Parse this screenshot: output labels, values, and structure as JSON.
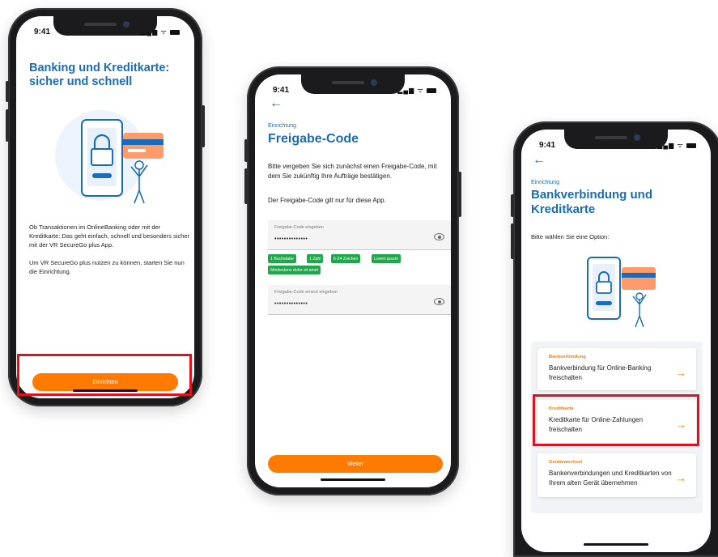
{
  "status_time": "9:41",
  "screen1": {
    "title": "Banking und Kreditkarte: sicher und schnell",
    "paragraph1": "Ob Transaktionen im OnlineBanking oder mit der Kreditkarte: Das geht einfach, schnell und besonders sicher mit der VR SecureGo plus App.",
    "paragraph2": "Um VR SecureGo plus nutzen zu können, starten Sie nun die Einrichtung.",
    "button_label": "Einrichten"
  },
  "screen2": {
    "eyebrow": "Einrichtung",
    "title": "Freigabe-Code",
    "paragraph1": "Bitte vergeben Sie sich zunächst einen Freigabe-Code, mit dem Sie zukünftig Ihre Aufträge bestätigen.",
    "paragraph2": "Der Freigabe-Code gilt nur für diese App.",
    "field1_label": "Freigabe-Code eingeben",
    "field1_value": "••••••••••••••",
    "chips": [
      "1 Buchstabe",
      "1 Zahl",
      "6-24 Zeichen",
      "Lorem ipsum",
      "Mindestens dolor sit amet"
    ],
    "field2_label": "Freigabe-Code erneut eingeben",
    "field2_value": "••••••••••••••",
    "button_label": "Weiter"
  },
  "screen3": {
    "eyebrow": "Einrichtung",
    "title": "Bankverbindung und Kreditkarte",
    "prompt": "Bitte wählen Sie eine Option:",
    "options": [
      {
        "tag": "Bankverbindung",
        "text": "Bankverbindung für Online-Banking freischalten"
      },
      {
        "tag": "Kreditkarte",
        "text": "Kreditkarte für Online-Zahlungen freischalten"
      },
      {
        "tag": "Gerätewechsel",
        "text": "Bankenverbindungen und Kreditkarten von Ihrem alten Gerät übernehmen"
      }
    ]
  },
  "colors": {
    "brand_blue": "#1a6bb8",
    "accent_orange": "#ff7a00",
    "highlight_red": "#e4101e",
    "chip_green": "#1fa84a"
  }
}
